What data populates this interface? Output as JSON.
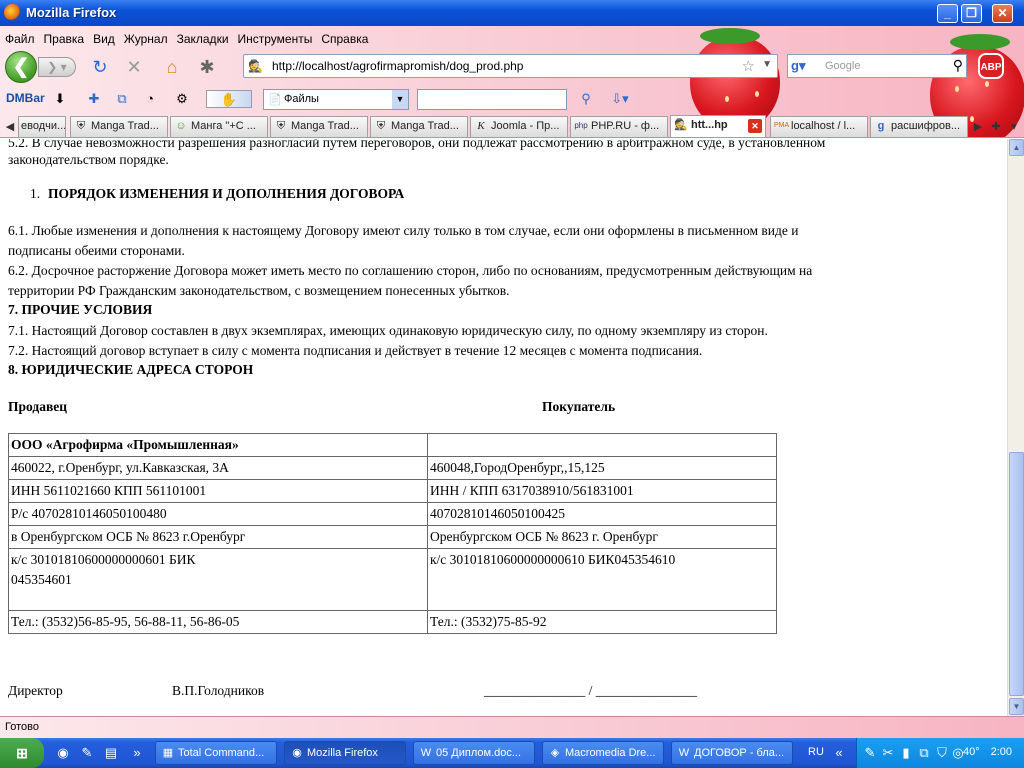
{
  "window": {
    "title": "Mozilla Firefox"
  },
  "menu": [
    "Файл",
    "Правка",
    "Вид",
    "Журнал",
    "Закладки",
    "Инструменты",
    "Справка"
  ],
  "nav": {
    "url": "http://localhost/agrofirmapromish/dog_prod.php",
    "search_placeholder": "Google",
    "abp": "ABP"
  },
  "dmbar": {
    "label": "DMBar",
    "folder_select": "Файлы"
  },
  "tabs": [
    "еводчи...",
    "Manga Trad...",
    "Манга \"+C ...",
    "Manga Trad...",
    "Manga Trad...",
    "Joomla - Пр...",
    "PHP.RU - ф...",
    "htt...hp",
    "localhost / l...",
    "расшифров..."
  ],
  "doc": {
    "l1": "5.2. В случае невозможности разрешения  разногласий путем переговоров, они подлежат рассмотрению в арбитражном суде, в установленном",
    "l2": "законодательством  порядке.",
    "h6num": "1.",
    "h6": "ПОРЯДОК ИЗМЕНЕНИЯ И ДОПОЛНЕНИЯ ДОГОВОРА",
    "p61a": " 6.1. Любые изменения  и дополнения к настоящему Договору имеют силу только в том случае, если они оформлены в письменном виде  и",
    "p61b": "подписаны обеими сторонами.",
    "p62a": "6.2. Досрочное расторжение Договора может иметь место по соглашению сторон, либо по основаниям, предусмотренным действующим на",
    "p62b": "территории РФ Гражданским законодательством, с возмещением понесенных убытков.",
    "h7": "7. ПРОЧИЕ УСЛОВИЯ",
    "p71": "7.1. Настоящий Договор составлен в двух экземплярах, имеющих одинаковую юридическую силу, по одному экземпляру из сторон.",
    "p72": "7.2. Настоящий договор вступает в силу с момента подписания и действует в течение 12 месяцев с момента подписания.",
    "h8": "8. ЮРИДИЧЕСКИЕ АДРЕСА СТОРОН",
    "seller": "Продавец",
    "buyer": "Покупатель",
    "table": [
      [
        "ООО «Агрофирма «Промышленная»",
        ""
      ],
      [
        "460022, г.Оренбург, ул.Кавказская, 3А",
        "460048,ГородОренбург,,15,125"
      ],
      [
        "ИНН 5611021660 КПП 561101001",
        "ИНН / КПП 6317038910/561831001"
      ],
      [
        "Р/с 40702810146050100480",
        "40702810146050100425"
      ],
      [
        "в Оренбургском  ОСБ № 8623 г.Оренбург",
        "Оренбургском ОСБ № 8623 г. Оренбург"
      ],
      [
        "к/с 30101810600000000601     БИК 045354601",
        " к/с 30101810600000000610 БИК045354610"
      ],
      [
        "Тел.: (3532)56-85-95, 56-88-11, 56-86-05",
        "Тел.: (3532)75-85-92"
      ]
    ],
    "director": "Директор",
    "director_name": "В.П.Голодников",
    "sign": "_______________ / _______________"
  },
  "status": "Готово",
  "taskbar": {
    "tasks": [
      "Total Command...",
      "Mozilla Firefox",
      "05 Диплом.doc...",
      "Macromedia Dre...",
      "ДОГОВОР - бла..."
    ],
    "lang": "RU",
    "temp": "40°",
    "clock": "2:00"
  },
  "colors": {
    "accent": "#245edb",
    "chrome_pink": "#f9cfd8"
  }
}
